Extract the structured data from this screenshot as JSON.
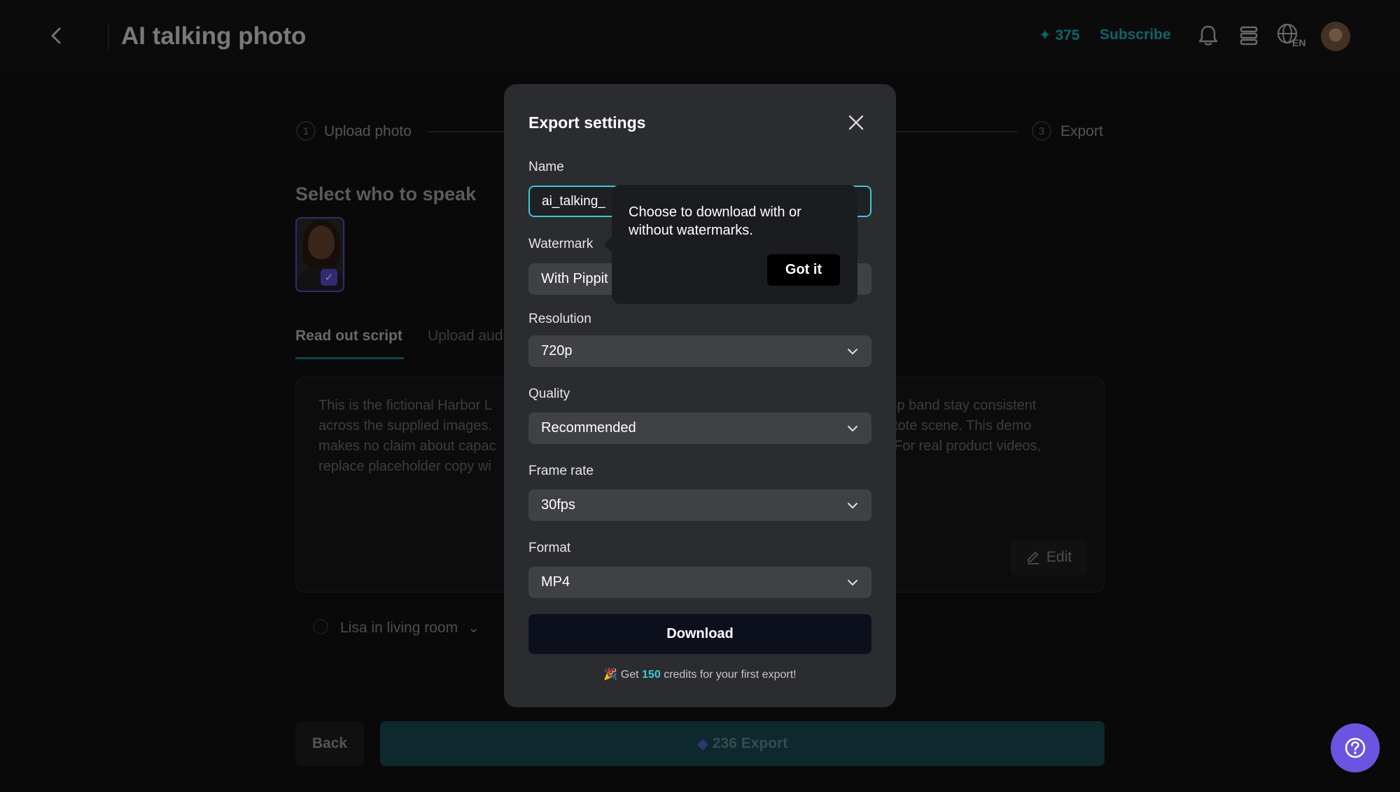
{
  "header": {
    "title": "AI talking photo",
    "credits": "375",
    "subscribe_label": "Subscribe",
    "language": "EN"
  },
  "steps": [
    {
      "number": "1",
      "label": "Upload photo"
    },
    {
      "number": "3",
      "label": "Export"
    }
  ],
  "main": {
    "select_title": "Select who to speak",
    "tabs": [
      {
        "label": "Read out script"
      },
      {
        "label": "Upload aud"
      }
    ],
    "script_text": "This is the fictional Harbor L                                                                                                                                         ip band stay consistent across the supplied images.                                                                                                                                           tote scene. This demo makes no claim about capac                                                                                                                                             For real product videos, replace placeholder copy wi",
    "script_left_lines": [
      "This is the fictional Harbor L",
      "across the supplied images.",
      "makes no claim about capac",
      "replace placeholder copy wi"
    ],
    "script_right_lines": [
      "ip band stay consistent",
      "tote scene. This demo",
      "For real product videos,"
    ],
    "edit_label": "Edit",
    "voice_label": "Lisa in living room",
    "back_label": "Back",
    "export_label": "236 Export"
  },
  "modal": {
    "title": "Export settings",
    "name_label": "Name",
    "name_value": "ai_talking_",
    "watermark_label": "Watermark",
    "watermark_value": "With Pippit",
    "resolution_label": "Resolution",
    "resolution_value": "720p",
    "quality_label": "Quality",
    "quality_value": "Recommended",
    "framerate_label": "Frame rate",
    "framerate_value": "30fps",
    "format_label": "Format",
    "format_value": "MP4",
    "download_label": "Download",
    "promo_prefix": "Get",
    "promo_amount": "150",
    "promo_suffix": "credits for your first export!"
  },
  "tooltip": {
    "text": "Choose to download with or without watermarks.",
    "button_label": "Got it"
  },
  "colors": {
    "accent": "#3ec7d9",
    "help_button": "#6a55e0",
    "export_button": "#1b4b53"
  }
}
